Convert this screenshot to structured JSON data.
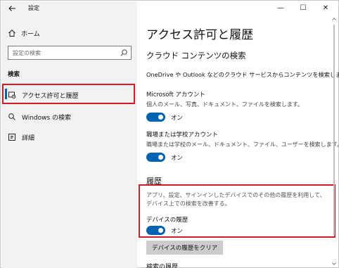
{
  "window": {
    "title": "設定",
    "controls": {
      "minimize": "—",
      "maximize": "☐",
      "close": "✕"
    }
  },
  "sidebar": {
    "home_label": "ホーム",
    "search_placeholder": "設定の検索",
    "section_label": "検索",
    "items": [
      {
        "label": "アクセス許可と履歴",
        "icon": "permissions-icon",
        "active": true
      },
      {
        "label": "Windows の検索",
        "icon": "search-icon"
      },
      {
        "label": "詳細",
        "icon": "more-details-icon"
      }
    ]
  },
  "main": {
    "title": "アクセス許可と履歴",
    "cloud_search": {
      "heading": "クラウド コンテンツの検索",
      "description": "OneDrive や Outlook などのクラウド サービスからコンテンツを検索します。",
      "microsoft_account": {
        "title": "Microsoft アカウント",
        "description": "個人のメール、写真、ドキュメント、ファイルを検索します。",
        "toggle_label": "オン"
      },
      "work_account": {
        "title": "職場または学校アカウント",
        "description": "職場または学校のメール、ドキュメント、ファイル、ユーザーを検索します。",
        "toggle_label": "オン"
      }
    },
    "history": {
      "heading": "履歴",
      "description": "アプリ、設定、サインインしたデバイスでのその他の履歴を利用して、デバイス上での検索を改善する。",
      "device_history": {
        "title": "デバイスの履歴",
        "toggle_label": "オン"
      },
      "clear_button": "デバイスの履歴をクリア",
      "next_section_partial": "検索の履歴"
    }
  },
  "colors": {
    "accent": "#0063b1",
    "highlight": "#d11a2a",
    "sidebar_bg": "#f2f2f2"
  }
}
